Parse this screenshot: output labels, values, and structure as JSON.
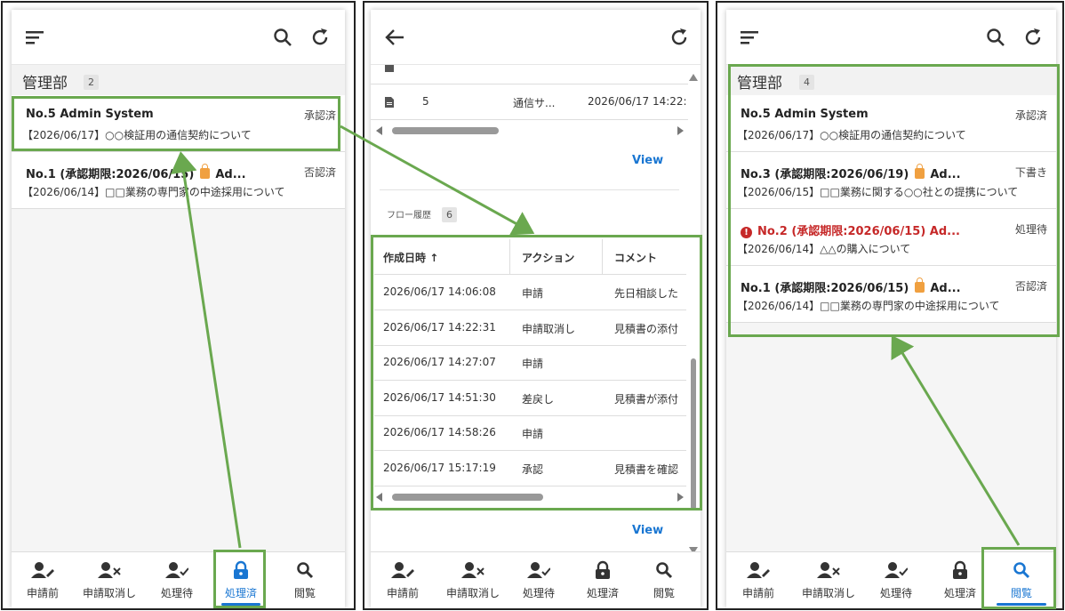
{
  "nav": [
    {
      "label": "申請前",
      "icon": "person-edit-icon"
    },
    {
      "label": "申請取消し",
      "icon": "person-cancel-icon"
    },
    {
      "label": "処理待",
      "icon": "person-check-icon"
    },
    {
      "label": "処理済",
      "icon": "lock-icon"
    },
    {
      "label": "閲覧",
      "icon": "search-icon"
    }
  ],
  "panel1": {
    "group_title": "管理部",
    "count": "2",
    "items": [
      {
        "title": "No.5 Admin System",
        "status": "承認済",
        "sub": "【2026/06/17】○○検証用の通信契約について"
      },
      {
        "title_pre": "No.1 (承認期限:2026/06/15)",
        "title_post": "Ad...",
        "status": "否認済",
        "sub": "【2026/06/14】□□業務の専門家の中途採用について"
      }
    ],
    "active_tab": "処理済"
  },
  "panel2": {
    "top_row": {
      "no": "5",
      "name": "通信サ...",
      "date": "2026/06/17 14:22:"
    },
    "view_label": "View",
    "history_label": "フロー履歴",
    "history_count": "6",
    "columns": [
      "作成日時",
      "アクション",
      "コメント"
    ],
    "rows": [
      {
        "date": "2026/06/17 14:06:08",
        "action": "申請",
        "comment": "先日相談した"
      },
      {
        "date": "2026/06/17 14:22:31",
        "action": "申請取消し",
        "comment": "見積書の添付"
      },
      {
        "date": "2026/06/17 14:27:07",
        "action": "申請",
        "comment": ""
      },
      {
        "date": "2026/06/17 14:51:30",
        "action": "差戻し",
        "comment": "見積書が添付"
      },
      {
        "date": "2026/06/17 14:58:26",
        "action": "申請",
        "comment": ""
      },
      {
        "date": "2026/06/17 15:17:19",
        "action": "承認",
        "comment": "見積書を確認"
      }
    ],
    "view_label_2": "View"
  },
  "panel3": {
    "group_title": "管理部",
    "count": "4",
    "items": [
      {
        "title": "No.5 Admin System",
        "status": "承認済",
        "sub": "【2026/06/17】○○検証用の通信契約について"
      },
      {
        "title_pre": "No.3 (承認期限:2026/06/19)",
        "title_post": "Ad...",
        "status": "下書き",
        "sub": "【2026/06/15】□□業務に関する○○社との提携について"
      },
      {
        "title_pre": "No.2 (承認期限:2026/06/15)",
        "title_post": "Ad...",
        "status": "処理待",
        "sub": "【2026/06/14】△△の購入について"
      },
      {
        "title_pre": "No.1 (承認期限:2026/06/15)",
        "title_post": "Ad...",
        "status": "否認済",
        "sub": "【2026/06/14】□□業務の専門家の中途採用について"
      }
    ],
    "active_tab": "閲覧"
  },
  "colors": {
    "highlight": "#6aa84f",
    "accent": "#1976d2",
    "overdue": "#c62828",
    "lock": "#f0a040"
  }
}
